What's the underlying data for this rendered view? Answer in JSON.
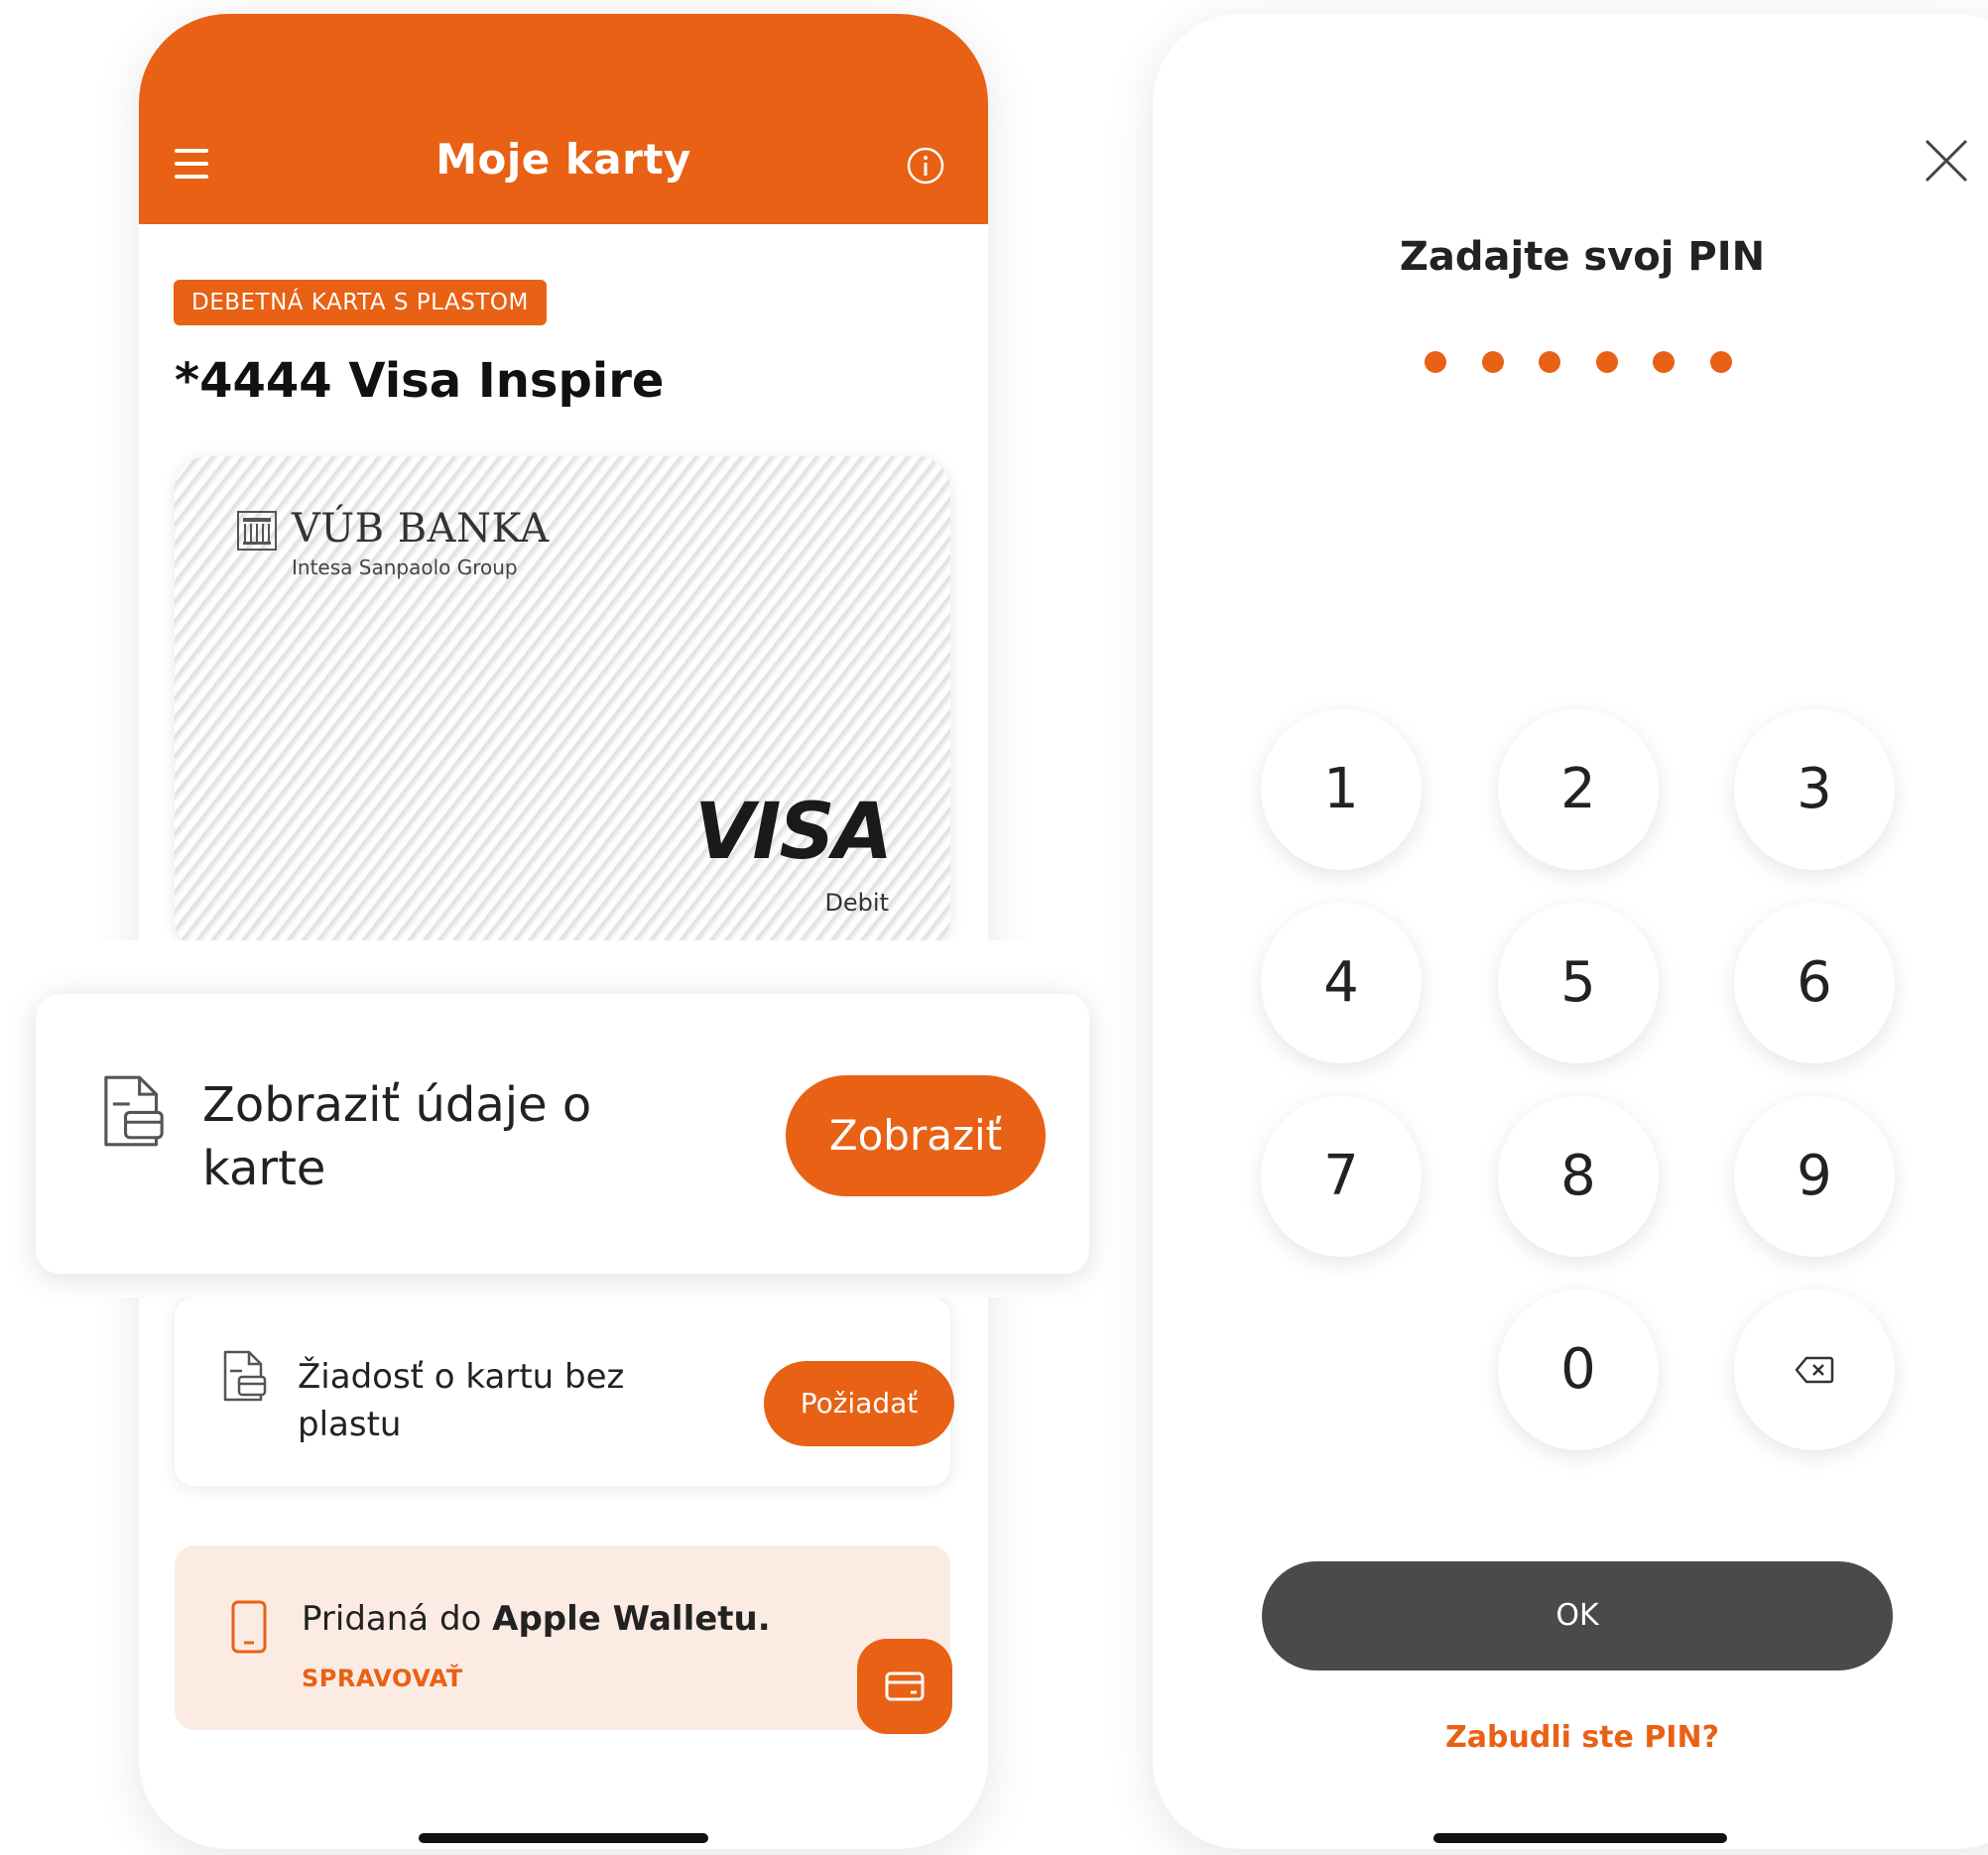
{
  "left_screen": {
    "header": {
      "title": "Moje karty"
    },
    "card": {
      "badge": "DEBETNÁ KARTA S PLASTOM",
      "name": "*4444 Visa Inspire",
      "bank_name": "VÚB BANKA",
      "bank_group": "Intesa Sanpaolo Group",
      "network": "VISA",
      "network_sub": "Debit"
    },
    "request": {
      "label": "Žiadosť o kartu bez plastu",
      "button": "Požiadať"
    },
    "wallet": {
      "text_plain": "Pridaná do ",
      "text_bold": "Apple Walletu.",
      "action": "SPRAVOVAŤ"
    }
  },
  "overlay": {
    "label": "Zobraziť údaje o karte",
    "button": "Zobraziť"
  },
  "right_screen": {
    "title": "Zadajte svoj PIN",
    "pin_length": 6,
    "keys": [
      "1",
      "2",
      "3",
      "4",
      "5",
      "6",
      "7",
      "8",
      "9",
      "0"
    ],
    "ok": "OK",
    "forgot": "Zabudli ste PIN?"
  },
  "colors": {
    "brand": "#e86114",
    "ok_button": "#4a4a4a",
    "wallet_bg": "#fcebe3"
  },
  "icons": [
    "menu-icon",
    "info-icon",
    "document-card-icon",
    "phone-icon",
    "card-icon",
    "close-icon",
    "backspace-icon"
  ]
}
